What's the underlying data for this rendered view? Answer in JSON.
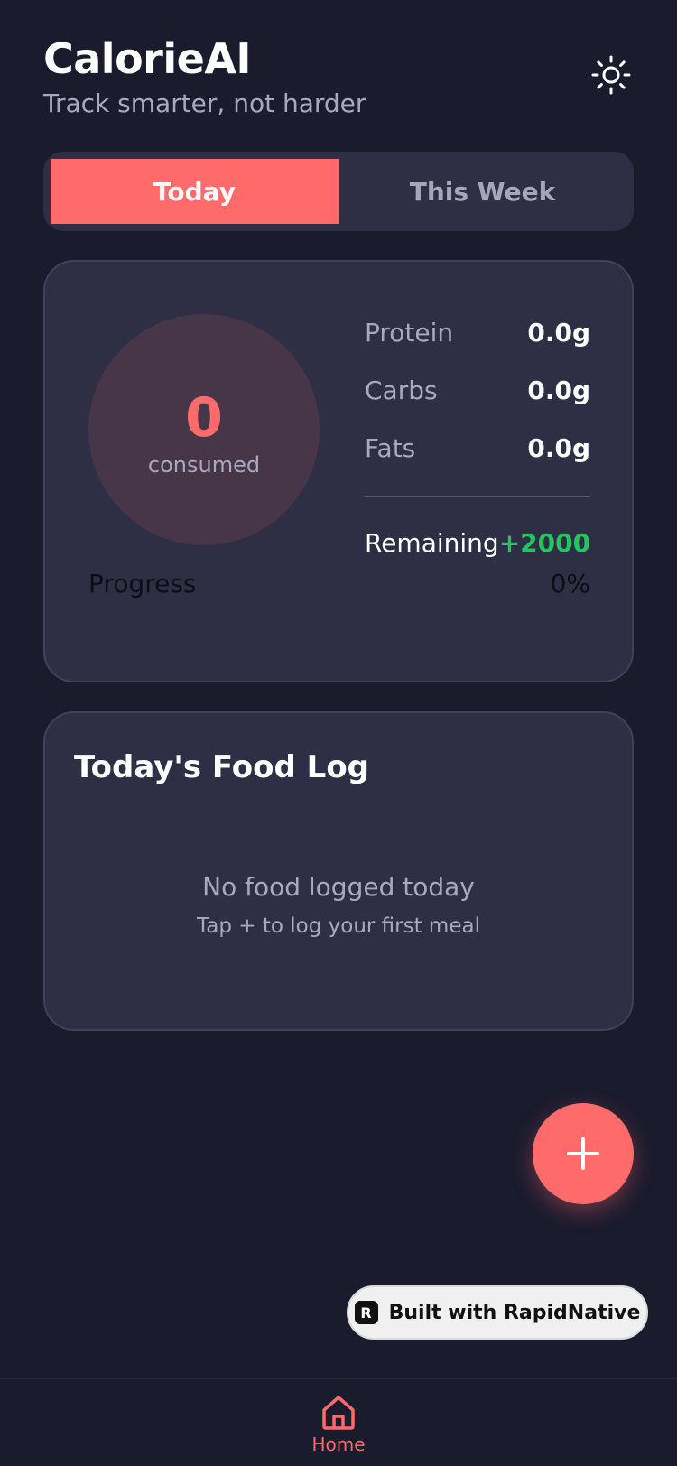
{
  "header": {
    "title": "CalorieAI",
    "subtitle": "Track smarter, not harder",
    "theme_icon": "sun-icon"
  },
  "tabs": [
    {
      "label": "Today",
      "active": true
    },
    {
      "label": "This Week",
      "active": false
    }
  ],
  "summary": {
    "consumed_value": "0",
    "consumed_label": "consumed",
    "macros": [
      {
        "name": "Protein",
        "value": "0.0g"
      },
      {
        "name": "Carbs",
        "value": "0.0g"
      },
      {
        "name": "Fats",
        "value": "0.0g"
      }
    ],
    "remaining_label": "Remaining",
    "remaining_value": "+2000",
    "progress_label": "Progress",
    "progress_value": "0%"
  },
  "food_log": {
    "title": "Today's Food Log",
    "empty_title": "No food logged today",
    "empty_hint": "Tap + to log your first meal"
  },
  "fab": {
    "icon": "plus-icon"
  },
  "badge": {
    "logo_letter": "R",
    "label": "Built with RapidNative"
  },
  "bottom_nav": {
    "items": [
      {
        "label": "Home",
        "icon": "home-icon",
        "active": true
      }
    ]
  },
  "colors": {
    "accent": "#ff6b6b",
    "background": "#1b1b2e",
    "card": "#2e2e45",
    "positive": "#22c55e"
  }
}
